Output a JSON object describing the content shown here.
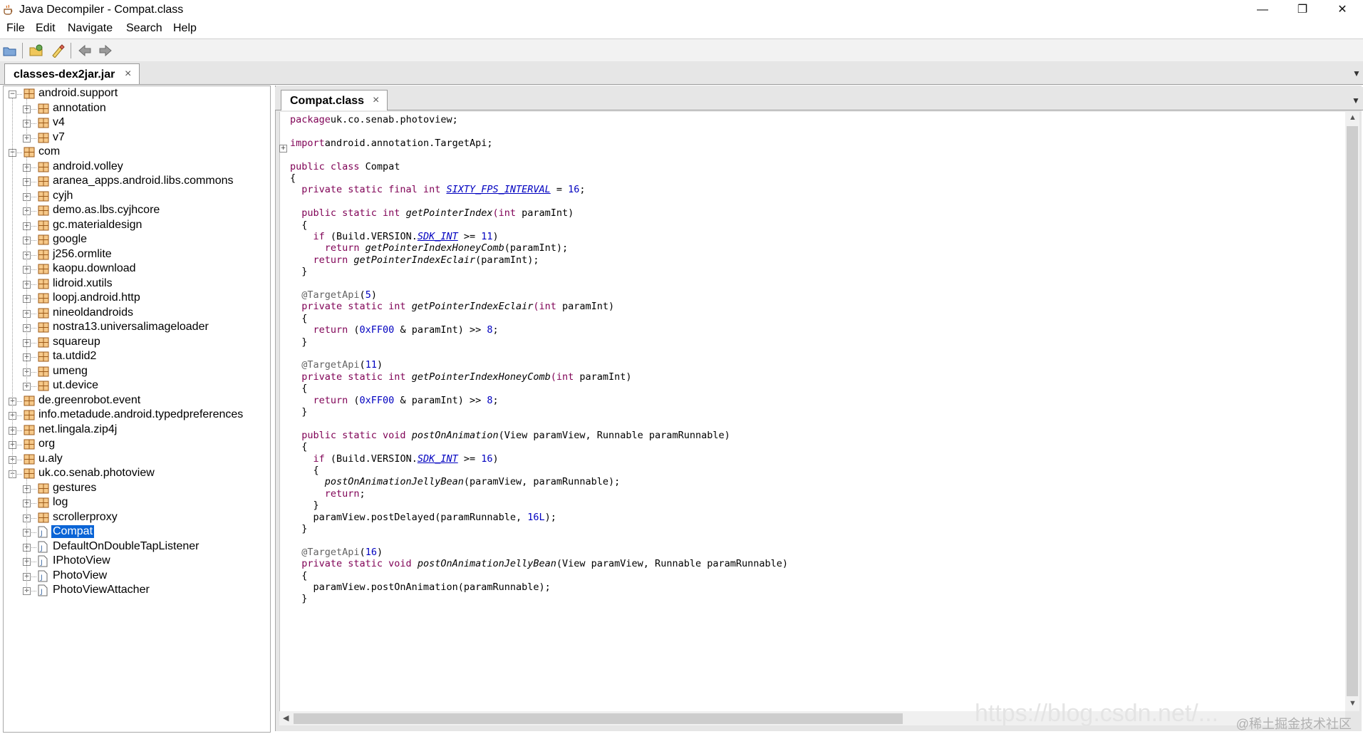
{
  "window": {
    "title": "Java Decompiler - Compat.class",
    "controls": {
      "minimize": "—",
      "restore": "❐",
      "close": "✕"
    }
  },
  "menu": [
    "File",
    "Edit",
    "Navigate",
    "Search",
    "Help"
  ],
  "toolbar": {
    "buttons": [
      "open-file-icon",
      "open-folder-icon",
      "clear-icon",
      "back-icon",
      "forward-icon"
    ]
  },
  "outer_tab": {
    "label": "classes-dex2jar.jar",
    "close": "×"
  },
  "inner_tab": {
    "label": "Compat.class",
    "close": "×"
  },
  "tree": [
    {
      "label": "android.support",
      "depth": 0,
      "kind": "package",
      "expanded": true
    },
    {
      "label": "annotation",
      "depth": 1,
      "kind": "package",
      "expanded": false
    },
    {
      "label": "v4",
      "depth": 1,
      "kind": "package",
      "expanded": false
    },
    {
      "label": "v7",
      "depth": 1,
      "kind": "package",
      "expanded": false
    },
    {
      "label": "com",
      "depth": 0,
      "kind": "package",
      "expanded": true
    },
    {
      "label": "android.volley",
      "depth": 1,
      "kind": "package",
      "expanded": false
    },
    {
      "label": "aranea_apps.android.libs.commons",
      "depth": 1,
      "kind": "package",
      "expanded": false
    },
    {
      "label": "cyjh",
      "depth": 1,
      "kind": "package",
      "expanded": false
    },
    {
      "label": "demo.as.lbs.cyjhcore",
      "depth": 1,
      "kind": "package",
      "expanded": false
    },
    {
      "label": "gc.materialdesign",
      "depth": 1,
      "kind": "package",
      "expanded": false
    },
    {
      "label": "google",
      "depth": 1,
      "kind": "package",
      "expanded": false
    },
    {
      "label": "j256.ormlite",
      "depth": 1,
      "kind": "package",
      "expanded": false
    },
    {
      "label": "kaopu.download",
      "depth": 1,
      "kind": "package",
      "expanded": false
    },
    {
      "label": "lidroid.xutils",
      "depth": 1,
      "kind": "package",
      "expanded": false
    },
    {
      "label": "loopj.android.http",
      "depth": 1,
      "kind": "package",
      "expanded": false
    },
    {
      "label": "nineoldandroids",
      "depth": 1,
      "kind": "package",
      "expanded": false
    },
    {
      "label": "nostra13.universalimageloader",
      "depth": 1,
      "kind": "package",
      "expanded": false
    },
    {
      "label": "squareup",
      "depth": 1,
      "kind": "package",
      "expanded": false
    },
    {
      "label": "ta.utdid2",
      "depth": 1,
      "kind": "package",
      "expanded": false
    },
    {
      "label": "umeng",
      "depth": 1,
      "kind": "package",
      "expanded": false
    },
    {
      "label": "ut.device",
      "depth": 1,
      "kind": "package",
      "expanded": false
    },
    {
      "label": "de.greenrobot.event",
      "depth": 0,
      "kind": "package",
      "expanded": false
    },
    {
      "label": "info.metadude.android.typedpreferences",
      "depth": 0,
      "kind": "package",
      "expanded": false
    },
    {
      "label": "net.lingala.zip4j",
      "depth": 0,
      "kind": "package",
      "expanded": false
    },
    {
      "label": "org",
      "depth": 0,
      "kind": "package",
      "expanded": false
    },
    {
      "label": "u.aly",
      "depth": 0,
      "kind": "package",
      "expanded": false
    },
    {
      "label": "uk.co.senab.photoview",
      "depth": 0,
      "kind": "package",
      "expanded": true
    },
    {
      "label": "gestures",
      "depth": 1,
      "kind": "package",
      "expanded": false
    },
    {
      "label": "log",
      "depth": 1,
      "kind": "package",
      "expanded": false
    },
    {
      "label": "scrollerproxy",
      "depth": 1,
      "kind": "package",
      "expanded": false
    },
    {
      "label": "Compat",
      "depth": 1,
      "kind": "class",
      "expanded": false,
      "selected": true
    },
    {
      "label": "DefaultOnDoubleTapListener",
      "depth": 1,
      "kind": "class",
      "expanded": false
    },
    {
      "label": "IPhotoView",
      "depth": 1,
      "kind": "class",
      "expanded": false
    },
    {
      "label": "PhotoView",
      "depth": 1,
      "kind": "class",
      "expanded": false
    },
    {
      "label": "PhotoViewAttacher",
      "depth": 1,
      "kind": "class",
      "expanded": false
    }
  ],
  "code": [
    {
      "line": 1,
      "tokens": [
        [
          "kw",
          "package"
        ],
        [
          "",
          "uk.co.senab.photoview;"
        ]
      ]
    },
    {
      "line": 3,
      "tokens": [
        [
          "kw",
          "import"
        ],
        [
          "",
          "android.annotation.TargetApi;"
        ]
      ]
    },
    {
      "line": 5,
      "tokens": [
        [
          "kw",
          "public class"
        ],
        [
          "",
          " Compat"
        ]
      ]
    },
    {
      "line": 6,
      "tokens": [
        [
          "",
          "{"
        ]
      ]
    },
    {
      "line": 7,
      "tokens": [
        [
          "kw",
          "  private static final int "
        ],
        [
          "fld",
          "SIXTY_FPS_INTERVAL"
        ],
        [
          "",
          " = "
        ],
        [
          "num",
          "16"
        ],
        [
          "",
          ";"
        ]
      ]
    },
    {
      "line": 9,
      "tokens": [
        [
          "kw",
          "  public static int "
        ],
        [
          "it",
          "getPointerIndex"
        ],
        [
          "kw",
          "(int"
        ],
        [
          "",
          " paramInt)"
        ]
      ]
    },
    {
      "line": 10,
      "tokens": [
        [
          "",
          "  {"
        ]
      ]
    },
    {
      "line": 11,
      "tokens": [
        [
          "kw",
          "    if"
        ],
        [
          "",
          " (Build.VERSION."
        ],
        [
          "fld",
          "SDK_INT"
        ],
        [
          "",
          " >= "
        ],
        [
          "num",
          "11"
        ],
        [
          "",
          ")"
        ]
      ]
    },
    {
      "line": 12,
      "tokens": [
        [
          "kw",
          "      return "
        ],
        [
          "it",
          "getPointerIndexHoneyComb"
        ],
        [
          "",
          "(paramInt);"
        ]
      ]
    },
    {
      "line": 13,
      "tokens": [
        [
          "kw",
          "    return "
        ],
        [
          "it",
          "getPointerIndexEclair"
        ],
        [
          "",
          "(paramInt);"
        ]
      ]
    },
    {
      "line": 14,
      "tokens": [
        [
          "",
          "  }"
        ]
      ]
    },
    {
      "line": 16,
      "tokens": [
        [
          "ann",
          "  @TargetApi"
        ],
        [
          "",
          "("
        ],
        [
          "num",
          "5"
        ],
        [
          "",
          ")"
        ]
      ]
    },
    {
      "line": 17,
      "tokens": [
        [
          "kw",
          "  private static int "
        ],
        [
          "it",
          "getPointerIndexEclair"
        ],
        [
          "kw",
          "(int"
        ],
        [
          "",
          " paramInt)"
        ]
      ]
    },
    {
      "line": 18,
      "tokens": [
        [
          "",
          "  {"
        ]
      ]
    },
    {
      "line": 19,
      "tokens": [
        [
          "kw",
          "    return"
        ],
        [
          "",
          " ("
        ],
        [
          "num",
          "0xFF00"
        ],
        [
          "",
          " & paramInt) >> "
        ],
        [
          "num",
          "8"
        ],
        [
          "",
          ";"
        ]
      ]
    },
    {
      "line": 20,
      "tokens": [
        [
          "",
          "  }"
        ]
      ]
    },
    {
      "line": 22,
      "tokens": [
        [
          "ann",
          "  @TargetApi"
        ],
        [
          "",
          "("
        ],
        [
          "num",
          "11"
        ],
        [
          "",
          ")"
        ]
      ]
    },
    {
      "line": 23,
      "tokens": [
        [
          "kw",
          "  private static int "
        ],
        [
          "it",
          "getPointerIndexHoneyComb"
        ],
        [
          "kw",
          "(int"
        ],
        [
          "",
          " paramInt)"
        ]
      ]
    },
    {
      "line": 24,
      "tokens": [
        [
          "",
          "  {"
        ]
      ]
    },
    {
      "line": 25,
      "tokens": [
        [
          "kw",
          "    return"
        ],
        [
          "",
          " ("
        ],
        [
          "num",
          "0xFF00"
        ],
        [
          "",
          " & paramInt) >> "
        ],
        [
          "num",
          "8"
        ],
        [
          "",
          ";"
        ]
      ]
    },
    {
      "line": 26,
      "tokens": [
        [
          "",
          "  }"
        ]
      ]
    },
    {
      "line": 28,
      "tokens": [
        [
          "kw",
          "  public static void "
        ],
        [
          "it",
          "postOnAnimation"
        ],
        [
          "",
          "(View paramView, Runnable paramRunnable)"
        ]
      ]
    },
    {
      "line": 29,
      "tokens": [
        [
          "",
          "  {"
        ]
      ]
    },
    {
      "line": 30,
      "tokens": [
        [
          "kw",
          "    if"
        ],
        [
          "",
          " (Build.VERSION."
        ],
        [
          "fld",
          "SDK_INT"
        ],
        [
          "",
          " >= "
        ],
        [
          "num",
          "16"
        ],
        [
          "",
          ")"
        ]
      ]
    },
    {
      "line": 31,
      "tokens": [
        [
          "",
          "    {"
        ]
      ]
    },
    {
      "line": 32,
      "tokens": [
        [
          "it",
          "      postOnAnimationJellyBean"
        ],
        [
          "",
          "(paramView, paramRunnable);"
        ]
      ]
    },
    {
      "line": 33,
      "tokens": [
        [
          "kw",
          "      return"
        ],
        [
          "",
          ";"
        ]
      ]
    },
    {
      "line": 34,
      "tokens": [
        [
          "",
          "    }"
        ]
      ]
    },
    {
      "line": 35,
      "tokens": [
        [
          "",
          "    paramView.postDelayed(paramRunnable, "
        ],
        [
          "num",
          "16L"
        ],
        [
          "",
          ");"
        ]
      ]
    },
    {
      "line": 36,
      "tokens": [
        [
          "",
          "  }"
        ]
      ]
    },
    {
      "line": 38,
      "tokens": [
        [
          "ann",
          "  @TargetApi"
        ],
        [
          "",
          "("
        ],
        [
          "num",
          "16"
        ],
        [
          "",
          ")"
        ]
      ]
    },
    {
      "line": 39,
      "tokens": [
        [
          "kw",
          "  private static void "
        ],
        [
          "it",
          "postOnAnimationJellyBean"
        ],
        [
          "",
          "(View paramView, Runnable paramRunnable)"
        ]
      ]
    },
    {
      "line": 40,
      "tokens": [
        [
          "",
          "  {"
        ]
      ]
    },
    {
      "line": 41,
      "tokens": [
        [
          "",
          "    paramView.postOnAnimation(paramRunnable);"
        ]
      ]
    },
    {
      "line": 42,
      "tokens": [
        [
          "",
          "  }"
        ]
      ]
    }
  ],
  "watermark": "@稀土掘金技术社区",
  "watermark_url": "https://blog.csdn.net/..."
}
